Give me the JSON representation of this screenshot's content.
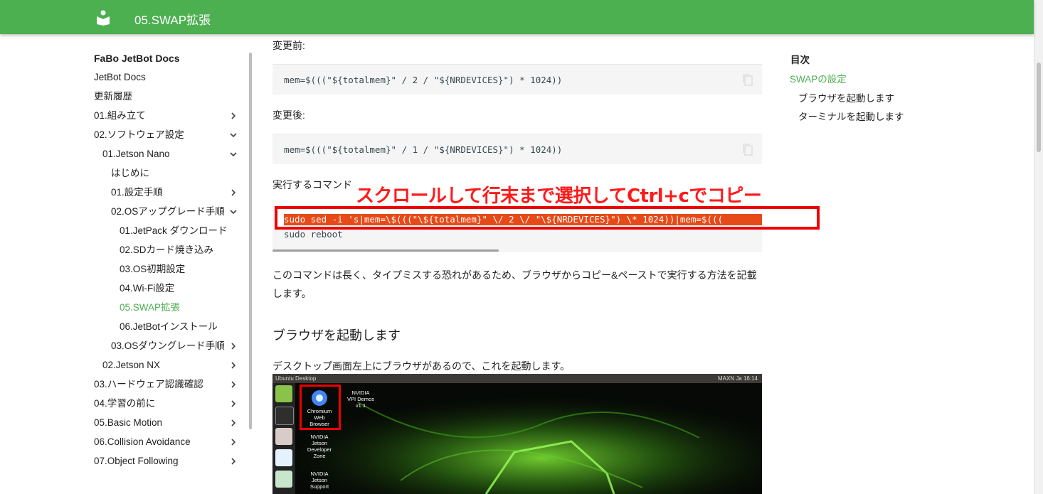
{
  "header": {
    "title": "05.SWAP拡張"
  },
  "sidebar": {
    "site_title": "FaBo JetBot Docs",
    "items": [
      {
        "label": "JetBot Docs",
        "chevron": ""
      },
      {
        "label": "更新履歴",
        "chevron": ""
      },
      {
        "label": "01.組み立て",
        "chevron": "right"
      },
      {
        "label": "02.ソフトウェア設定",
        "chevron": "down"
      },
      {
        "label": "01.Jetson Nano",
        "chevron": "down"
      },
      {
        "label": "はじめに",
        "chevron": ""
      },
      {
        "label": "01.設定手順",
        "chevron": "right"
      },
      {
        "label": "02.OSアップグレード手順",
        "chevron": "down"
      },
      {
        "label": "01.JetPack ダウンロード",
        "chevron": ""
      },
      {
        "label": "02.SDカード焼き込み",
        "chevron": ""
      },
      {
        "label": "03.OS初期設定",
        "chevron": ""
      },
      {
        "label": "04.Wi-Fi設定",
        "chevron": ""
      },
      {
        "label": "05.SWAP拡張",
        "chevron": "",
        "active": true
      },
      {
        "label": "06.JetBotインストール",
        "chevron": ""
      },
      {
        "label": "03.OSダウングレード手順",
        "chevron": "right"
      },
      {
        "label": "02.Jetson NX",
        "chevron": "right"
      },
      {
        "label": "03.ハードウェア認識確認",
        "chevron": "right"
      },
      {
        "label": "04.学習の前に",
        "chevron": "right"
      },
      {
        "label": "05.Basic Motion",
        "chevron": "right"
      },
      {
        "label": "06.Collision Avoidance",
        "chevron": "right"
      },
      {
        "label": "07.Object Following",
        "chevron": "right"
      }
    ]
  },
  "content": {
    "before_label": "変更前:",
    "before_code": "mem=$(((\"${totalmem}\" / 2 / \"${NRDEVICES}\") * 1024))",
    "after_label": "変更後:",
    "after_code": "mem=$(((\"${totalmem}\" / 1 / \"${NRDEVICES}\") * 1024))",
    "command_label": "実行するコマンド",
    "command_line1": "sudo sed -i 's|mem=\\$(((\"\\${totalmem}\" \\/ 2 \\/ \"\\${NRDEVICES}\") \\* 1024))|mem=$(((",
    "command_line2": "sudo reboot",
    "note_line1": "このコマンドは長く、タイプミスする恐れがあるため、ブラウザからコピー&ペーストで実行する方法を記載",
    "note_line2": "します。",
    "section_heading": "ブラウザを起動します",
    "section_text": "デスクトップ画面左上にブラウザがあるので、これを起動します。"
  },
  "annotation": {
    "text": "スクロールして行末まで選択してCtrl+cでコピー"
  },
  "toc": {
    "title": "目次",
    "items": [
      {
        "label": "SWAPの設定",
        "active": true
      },
      {
        "label": "ブラウザを起動します"
      },
      {
        "label": "ターミナルを起動します"
      }
    ]
  },
  "screenshot": {
    "topbar_title": "Ubuntu Desktop",
    "tray": "MAXN  Ja  16:14",
    "icons": [
      {
        "label": "Chromium\nWeb\nBrowser"
      },
      {
        "label": "NVIDIA\nVPI Demos\nv1.1"
      },
      {
        "label": "NVIDIA\nJetson\nDeveloper\nZone"
      },
      {
        "label": "NVIDIA\nJetson\nSupport"
      }
    ]
  },
  "colors": {
    "primary": "#4caf50",
    "annotation": "#ff1a1a",
    "selection": "#e64a19"
  }
}
